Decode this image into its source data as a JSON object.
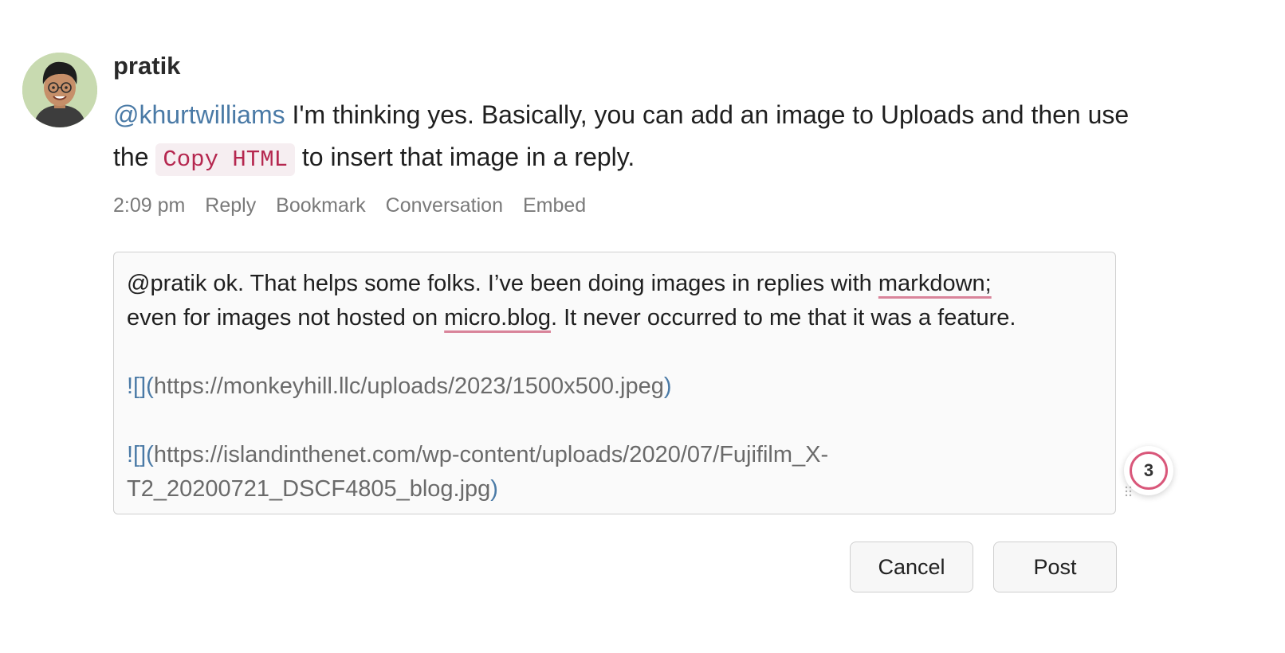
{
  "post": {
    "author": "pratik",
    "mention": "@khurtwilliams",
    "text_before_code": " I'm thinking yes. Basically, you can add an image to Uploads and then use the ",
    "code": "Copy HTML",
    "text_after_code": " to insert that image in a reply.",
    "meta": {
      "time": "2:09 pm",
      "reply": "Reply",
      "bookmark": "Bookmark",
      "conversation": "Conversation",
      "embed": "Embed"
    }
  },
  "reply_editor": {
    "line1_a": "@pratik ok. That helps some folks. I’ve been doing images in replies with ",
    "line1_spell": "markdown;",
    "line2_a": "even for images not hosted on ",
    "line2_spell": "micro.blog",
    "line2_b": ". It never occurred to me that it was a feature.",
    "md1_prefix": "![](",
    "md1_url": "https://monkeyhill.llc/uploads/2023/1500x500.jpeg",
    "md1_suffix": ")",
    "md2_prefix": "![](",
    "md2_url_a": "https://islandinthenet.com/wp-content/uploads/2020/07/Fujifilm_X-",
    "md2_url_b": "T2_20200721_DSCF4805_blog.jpg",
    "md2_suffix": ")"
  },
  "badge": {
    "count": "3"
  },
  "buttons": {
    "cancel": "Cancel",
    "post": "Post"
  },
  "icons": {
    "avatar": "avatar-memoji",
    "grip": "resize-grip-icon"
  },
  "colors": {
    "mention": "#4a7aa6",
    "code_text": "#b5274f",
    "code_bg": "#f6eef1",
    "spell_underline": "#d9849a",
    "badge_ring": "#d9577a"
  }
}
